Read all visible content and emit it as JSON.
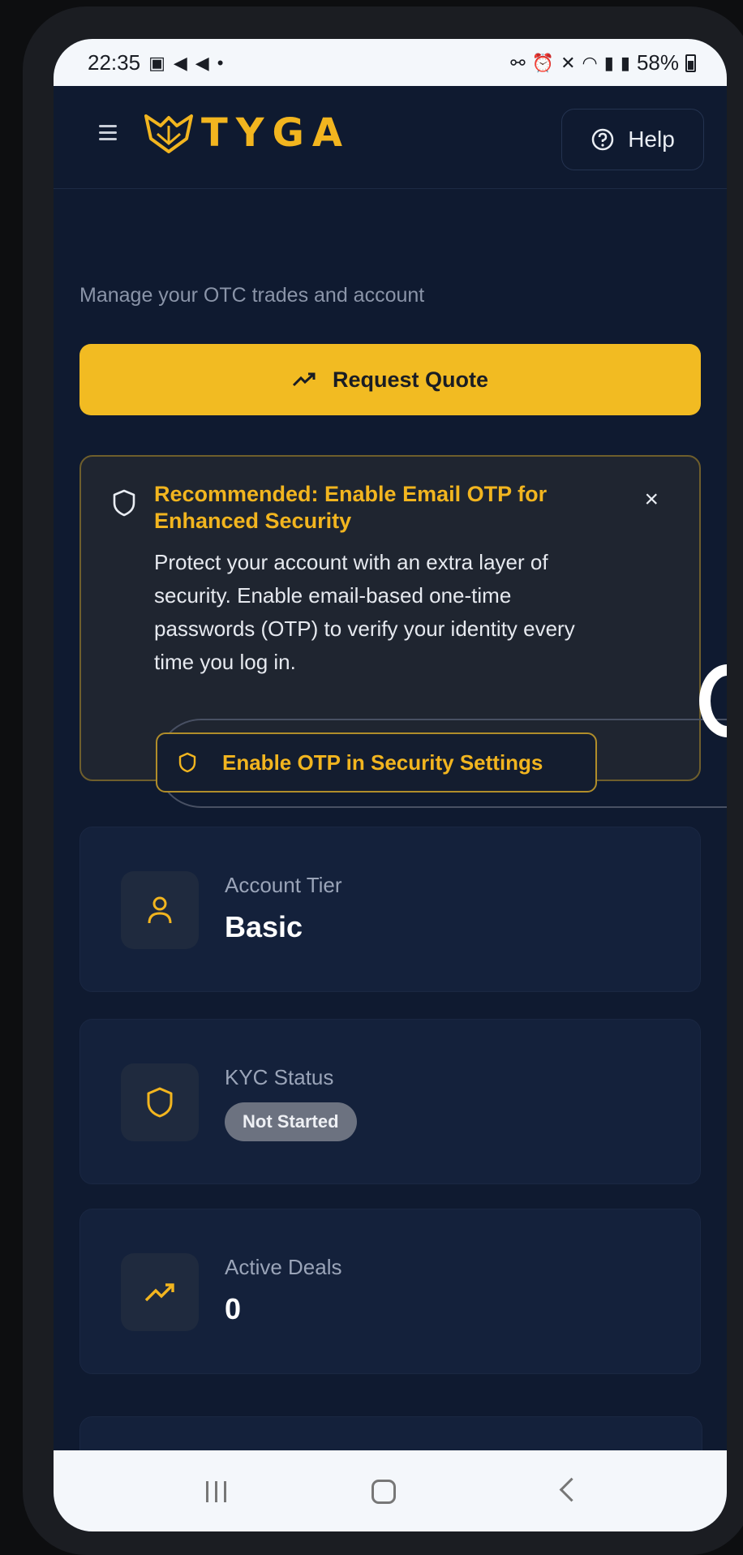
{
  "status_bar": {
    "time": "22:35",
    "notification_icons": [
      "gallery-icon",
      "telegram-icon",
      "telegram-icon",
      "dot-icon"
    ],
    "system_icons": [
      "link-icon",
      "alarm-icon",
      "mute-icon",
      "wifi-icon",
      "signal-icon",
      "signal-icon"
    ],
    "battery": "58%"
  },
  "header": {
    "brand": "TYGA",
    "help_label": "Help"
  },
  "page": {
    "subtitle": "Manage your OTC trades and account",
    "request_quote_label": "Request Quote"
  },
  "security_alert": {
    "title": "Recommended: Enable Email OTP for Enhanced Security",
    "body": "Protect your account with an extra layer of security. Enable email-based one-time passwords (OTP) to verify your identity every time you log in.",
    "button_label": "Enable OTP in Security Settings",
    "close_glyph": "×"
  },
  "cards": [
    {
      "label": "Account Tier",
      "value": "Basic",
      "icon": "user-icon"
    },
    {
      "label": "KYC Status",
      "value": "Not Started",
      "icon": "shield-icon"
    },
    {
      "label": "Active Deals",
      "value": "0",
      "icon": "trending-up-icon"
    }
  ],
  "colors": {
    "accent": "#f2bb22",
    "background": "#0f1a30",
    "card": "#14213b",
    "badge": "#6c7280"
  }
}
